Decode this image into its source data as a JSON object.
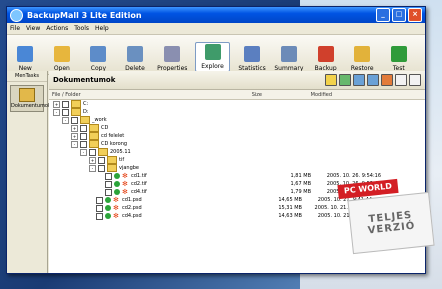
{
  "window": {
    "title": "BackupMall 3 Lite Edition",
    "minimize": "_",
    "maximize": "□",
    "close": "×"
  },
  "menu": [
    "File",
    "View",
    "Actions",
    "Tools",
    "Help"
  ],
  "toolbar": [
    {
      "label": "New",
      "icon": "new-icon",
      "color": "#4a87d6"
    },
    {
      "label": "Open",
      "icon": "open-icon",
      "color": "#e7b63d"
    },
    {
      "label": "Copy",
      "icon": "copy-icon",
      "color": "#5d8cc9"
    },
    {
      "label": "Delete",
      "icon": "delete-icon",
      "color": "#6a90c0"
    },
    {
      "label": "Properties",
      "icon": "properties-icon",
      "color": "#8a8fb0"
    },
    {
      "label": "Explore",
      "icon": "explore-icon",
      "color": "#3f9b6a",
      "active": true
    },
    {
      "label": "Statistics",
      "icon": "statistics-icon",
      "color": "#5b7fc0"
    },
    {
      "label": "Summary",
      "icon": "summary-icon",
      "color": "#6c8bb8"
    },
    {
      "label": "Backup",
      "icon": "backup-icon",
      "color": "#d0402c"
    },
    {
      "label": "Restore",
      "icon": "restore-icon",
      "color": "#e2b23a"
    },
    {
      "label": "Test",
      "icon": "test-icon",
      "color": "#2f9b3a"
    }
  ],
  "sidebar": {
    "header": "MenTasks",
    "item": "Dokumentumok"
  },
  "main": {
    "title": "Dokumentumok",
    "col_file": "File / Folder",
    "col_size": "Size",
    "col_modified": "Modified"
  },
  "tree": [
    {
      "indent": 0,
      "exp": "+",
      "name": "C:",
      "type": "folder"
    },
    {
      "indent": 0,
      "exp": "-",
      "name": "D:",
      "type": "folder"
    },
    {
      "indent": 1,
      "exp": "-",
      "name": "_work",
      "type": "folder"
    },
    {
      "indent": 2,
      "exp": "+",
      "name": "CD",
      "type": "folder"
    },
    {
      "indent": 2,
      "exp": "+",
      "name": "cd felelet",
      "type": "folder"
    },
    {
      "indent": 2,
      "exp": "-",
      "name": "CD korong",
      "type": "folder"
    },
    {
      "indent": 3,
      "exp": "-",
      "name": "2005.11",
      "type": "folder"
    },
    {
      "indent": 4,
      "exp": "+",
      "name": "tif",
      "type": "folder"
    },
    {
      "indent": 4,
      "exp": "-",
      "name": "vjangbe",
      "type": "folder"
    },
    {
      "indent": 5,
      "exp": "",
      "name": "cd1.tif",
      "type": "file",
      "size": "1,81 MB",
      "modified": "2005. 10. 26. 9:54:16"
    },
    {
      "indent": 5,
      "exp": "",
      "name": "cd2.tif",
      "type": "file",
      "size": "1,67 MB",
      "modified": "2005. 10. 26. 9:53:40"
    },
    {
      "indent": 5,
      "exp": "",
      "name": "cd4.tif",
      "type": "file",
      "size": "1,79 MB",
      "modified": "2005. 10. 26. 9:53:16"
    },
    {
      "indent": 4,
      "exp": "",
      "name": "cd1.psd",
      "type": "file",
      "size": "14,65 MB",
      "modified": "2005. 10. 21. 9:41:44"
    },
    {
      "indent": 4,
      "exp": "",
      "name": "cd2.psd",
      "type": "file",
      "size": "15,31 MB",
      "modified": "2005. 10. 21. 10:20:42"
    },
    {
      "indent": 4,
      "exp": "",
      "name": "cd4.psd",
      "type": "file",
      "size": "14,63 MB",
      "modified": "2005. 10. 21. 9:42:44"
    }
  ],
  "promo": {
    "logo": "PC WORLD",
    "line1": "TELJES",
    "line2": "VERZIÓ"
  }
}
